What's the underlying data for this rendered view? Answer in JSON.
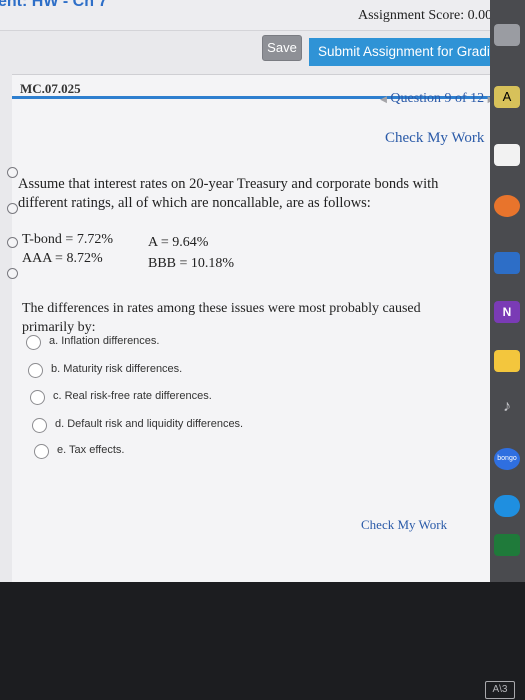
{
  "header": {
    "assignment_title": "ent: HW - Ch 7",
    "score_text": "Assignment Score: 0.00%",
    "save_label": "Save",
    "submit_label": "Submit Assignment for Grading"
  },
  "question": {
    "id": "MC.07.025",
    "nav_text": "Question 9 of 12",
    "check_my_work_top": "Check My Work",
    "stem": "Assume that interest rates on 20-year Treasury and corporate bonds with different ratings, all of which are noncallable, are as follows:",
    "rates": {
      "tbond": "T-bond = 7.72%",
      "aaa": "AAA = 8.72%",
      "a": "A = 9.64%",
      "bbb": "BBB = 10.18%"
    },
    "prompt": "The differences in rates among these issues were most probably caused primarily by:",
    "options": [
      {
        "label": "a. Inflation differences."
      },
      {
        "label": "b. Maturity risk differences."
      },
      {
        "label": "c. Real risk-free rate differences."
      },
      {
        "label": "d. Default risk and liquidity differences."
      },
      {
        "label": "e. Tax effects."
      }
    ],
    "check_my_work_bottom": "Check My Work"
  },
  "dock": {
    "icons": [
      "notes-icon",
      "blackboard-icon",
      "onenote-icon",
      "pen-icon",
      "music-icon",
      "bongo-icon",
      "cloud-icon",
      "app-icon"
    ],
    "bongo_label": "bongo",
    "onenote_label": "N",
    "top_letter": "A"
  },
  "bezel": {
    "label": "A\\3"
  },
  "colors": {
    "accent": "#2e7fcf",
    "submit": "#2f93d6",
    "link": "#2a5aa8"
  }
}
